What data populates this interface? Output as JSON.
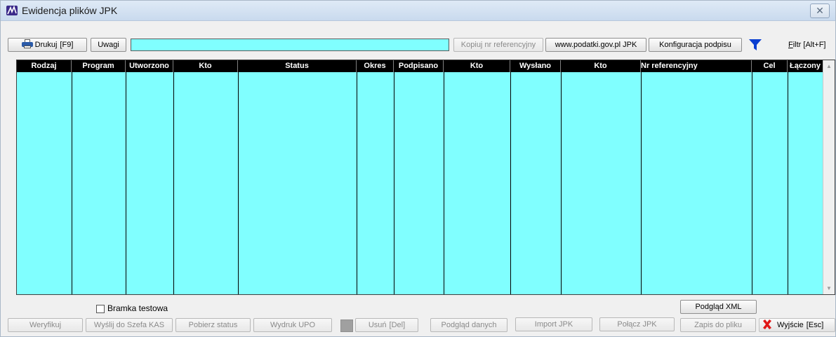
{
  "window": {
    "title": "Ewidencja plików JPK",
    "close_glyph": "✕"
  },
  "toolbar": {
    "print_label": "Drukuj",
    "print_key": "[F9]",
    "remarks_label": "Uwagi",
    "remarks_value": "",
    "copy_ref_label": "Kopiuj nr referencyjny",
    "website_label": "www.podatki.gov.pl  JPK",
    "signature_config_label": "Konfiguracja podpisu",
    "filter_label_prefix": "F",
    "filter_label_rest": "iltr  [Alt+F]"
  },
  "grid": {
    "columns": [
      "Rodzaj",
      "Program",
      "Utworzono",
      "Kto",
      "Status",
      "Okres",
      "Podpisano",
      "Kto",
      "Wysłano",
      "Kto",
      "Nr referencyjny",
      "Cel",
      "Łączony"
    ],
    "rows": []
  },
  "options": {
    "test_gateway_label": "Bramka testowa",
    "test_gateway_checked": false
  },
  "actions": {
    "verify": "Weryfikuj",
    "send_kas": "Wyślij do Szefa KAS",
    "get_status": "Pobierz status",
    "print_upo": "Wydruk UPO",
    "delete": "Usuń",
    "delete_key": "[Del]",
    "preview_data": "Podgląd danych",
    "import_jpk": "Import JPK",
    "merge_jpk": "Połącz JPK",
    "save_file": "Zapis do pliku",
    "preview_xml": "Podgląd XML",
    "exit": "Wyjście",
    "exit_key": "[Esc]"
  },
  "colors": {
    "grid_background": "#80ffff",
    "header_background": "#000000",
    "filter_icon": "#0a3fd1",
    "exit_icon": "#e01818"
  }
}
